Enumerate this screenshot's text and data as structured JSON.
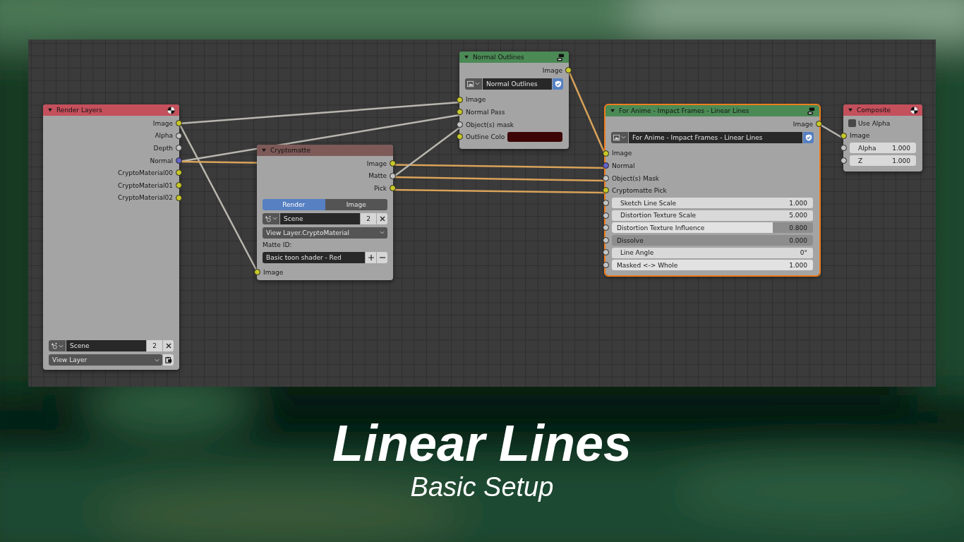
{
  "editor": {
    "nodes": [
      {
        "kind": "render_layers",
        "title": "Render Layers",
        "color": "#c4505c",
        "selected": false,
        "outputs": [
          {
            "label": "Image",
            "color": "#c7c729"
          },
          {
            "label": "Alpha",
            "color": "#c4c4c4"
          },
          {
            "label": "Depth",
            "color": "#c4c4c4"
          },
          {
            "label": "Normal",
            "color": "#6363c7"
          },
          {
            "label": "CryptoMaterial00",
            "color": "#c7c729"
          },
          {
            "label": "CryptoMaterial01",
            "color": "#c7c729"
          },
          {
            "label": "CryptoMaterial02",
            "color": "#c7c729"
          }
        ],
        "scene": {
          "value": "Scene",
          "users": "2"
        },
        "view_layer": "View Layer"
      },
      {
        "kind": "cryptomatte",
        "title": "Cryptomatte",
        "color": "#7d5a58",
        "selected": false,
        "outputs": [
          {
            "label": "Image",
            "color": "#c7c729"
          },
          {
            "label": "Matte",
            "color": "#c4c4c4"
          },
          {
            "label": "Pick",
            "color": "#c7c729"
          }
        ],
        "tabs": [
          {
            "label": "Render",
            "selected": true
          },
          {
            "label": "Image",
            "selected": false
          }
        ],
        "scene": {
          "value": "Scene",
          "users": "2"
        },
        "layer": "View Layer.CryptoMaterial",
        "matte_id_label": "Matte ID:",
        "matte_id": "Basic toon shader - Red",
        "inputs": [
          {
            "kind": "plain",
            "label": "Image",
            "color": "#c7c729"
          }
        ]
      },
      {
        "kind": "group",
        "title": "Normal Outlines",
        "color": "#4b8a55",
        "selected": false,
        "outputs": [
          {
            "label": "Image",
            "color": "#c7c729"
          }
        ],
        "group_name": "Normal Outlines",
        "fake_user": true,
        "inputs": [
          {
            "kind": "plain",
            "label": "Image",
            "color": "#c7c729"
          },
          {
            "kind": "plain",
            "label": "Normal Pass",
            "color": "#c7c729"
          },
          {
            "kind": "plain",
            "label": "Object(s) mask",
            "color": "#c4c4c4"
          },
          {
            "kind": "swatch",
            "label": "Outline Colo",
            "color": "#c7c729",
            "swatch": {
              "color": "#3d0505"
            }
          }
        ]
      },
      {
        "kind": "group",
        "title": "For Anime - Impact Frames - Linear Lines",
        "color": "#4b8a55",
        "selected": true,
        "outputs": [
          {
            "label": "Image",
            "color": "#c7c729"
          }
        ],
        "group_name": "For Anime - Impact Frames - Linear Lines",
        "fake_user": true,
        "inputs": [
          {
            "kind": "plain",
            "label": "Image",
            "color": "#c7c729"
          },
          {
            "kind": "plain",
            "label": "Normal",
            "color": "#6363c7"
          },
          {
            "kind": "plain",
            "label": "Object(s) Mask",
            "color": "#c4c4c4"
          },
          {
            "kind": "plain",
            "label": "Cryptomatte Pick",
            "color": "#c7c729"
          },
          {
            "kind": "number",
            "label": "Sketch Line Scale",
            "value": "1.000",
            "color": "#c4c4c4"
          },
          {
            "kind": "number",
            "label": "Distortion Texture Scale",
            "value": "5.000",
            "color": "#c4c4c4"
          },
          {
            "kind": "factor",
            "label": "Distortion Texture Influence",
            "value": "0.800",
            "level": 0.8,
            "color": "#c4c4c4"
          },
          {
            "kind": "factor",
            "label": "Dissolve",
            "value": "0.000",
            "level": 0,
            "color": "#c4c4c4"
          },
          {
            "kind": "number",
            "label": "Line Angle",
            "value": "0°",
            "color": "#c4c4c4"
          },
          {
            "kind": "factor",
            "label": "Masked <-> Whole",
            "value": "1.000",
            "level": 1,
            "color": "#c4c4c4"
          }
        ]
      },
      {
        "kind": "composite",
        "title": "Composite",
        "color": "#c4505c",
        "selected": false,
        "use_alpha": {
          "label": "Use Alpha",
          "checked": false
        },
        "inputs": [
          {
            "kind": "plain",
            "label": "Image",
            "color": "#c7c729"
          },
          {
            "kind": "number",
            "label": "Alpha",
            "value": "1.000",
            "color": "#c4c4c4"
          },
          {
            "kind": "number",
            "label": "Z",
            "value": "1.000",
            "color": "#c4c4c4"
          }
        ]
      }
    ]
  },
  "title": "Linear Lines",
  "subtitle": "Basic Setup"
}
